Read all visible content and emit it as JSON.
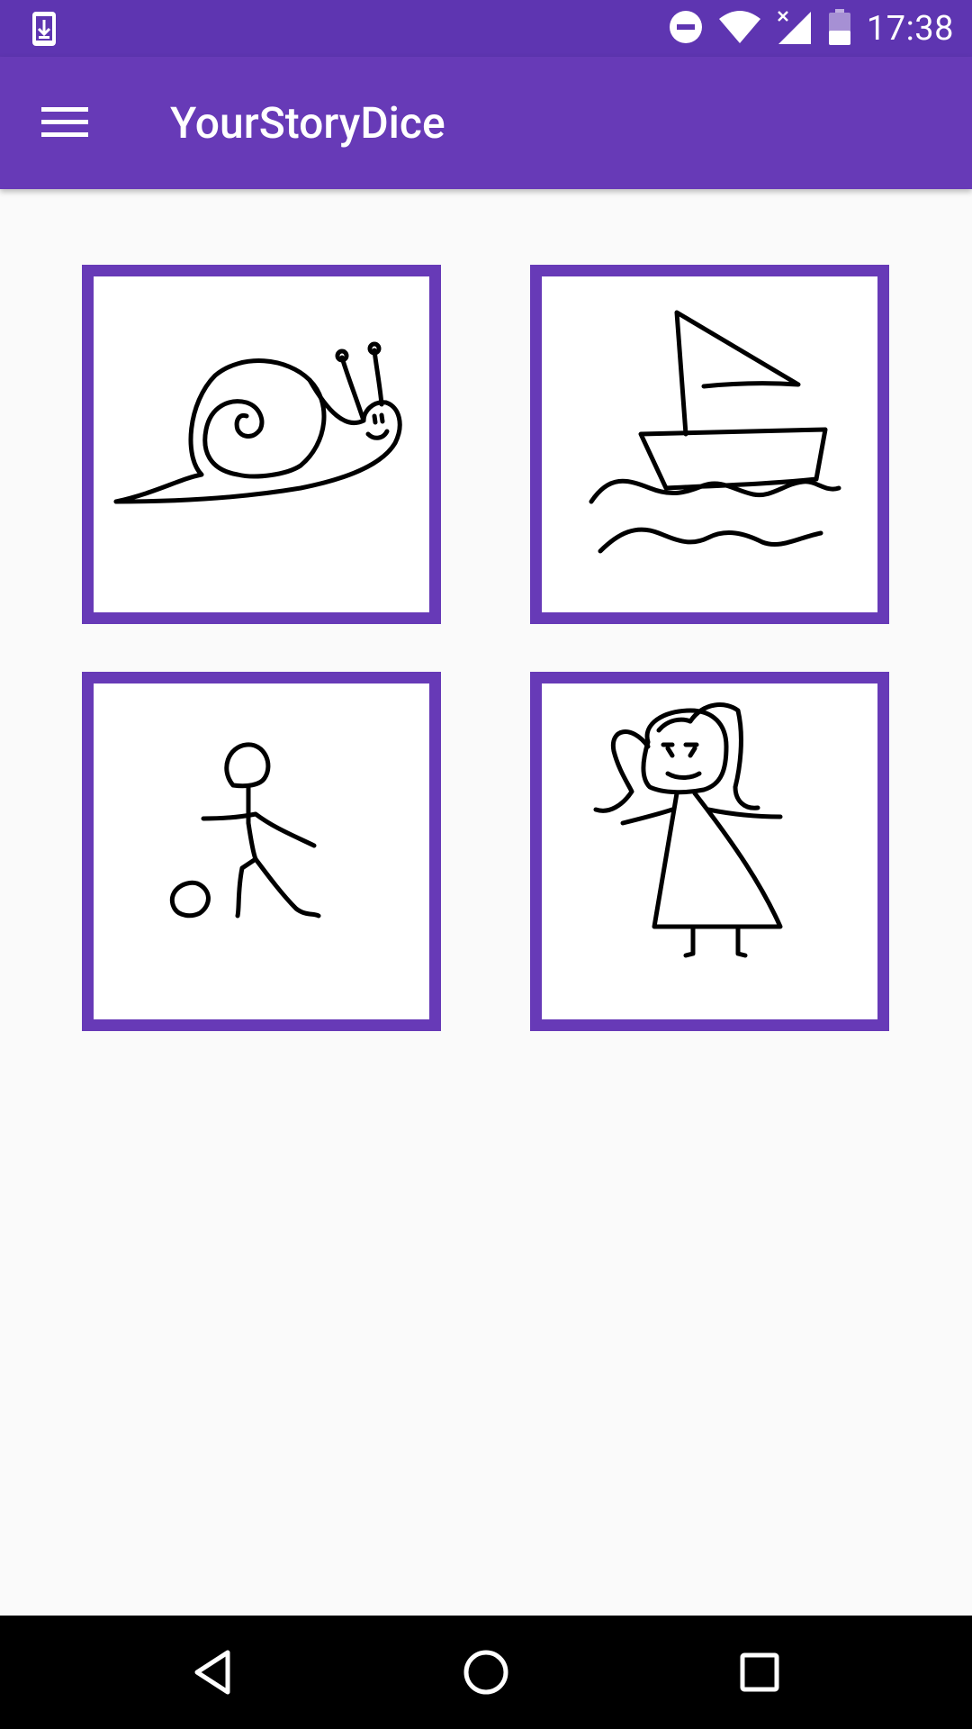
{
  "status_bar": {
    "time": "17:38",
    "icons": [
      "download-notification-icon",
      "do-not-disturb-icon",
      "wifi-icon",
      "mobile-signal-icon",
      "battery-icon"
    ]
  },
  "app_bar": {
    "title": "YourStoryDice",
    "menu_icon": "hamburger-menu-icon"
  },
  "dice": [
    {
      "image": "snail-drawing"
    },
    {
      "image": "sailboat-drawing"
    },
    {
      "image": "stick-figure-kicking-ball-drawing"
    },
    {
      "image": "girl-drawing"
    }
  ],
  "nav_bar": {
    "buttons": [
      "back-icon",
      "home-icon",
      "recents-icon"
    ]
  },
  "colors": {
    "status_bar": "#5e35b1",
    "app_bar": "#673ab7",
    "card_border": "#673ab7",
    "background": "#fafafa"
  }
}
